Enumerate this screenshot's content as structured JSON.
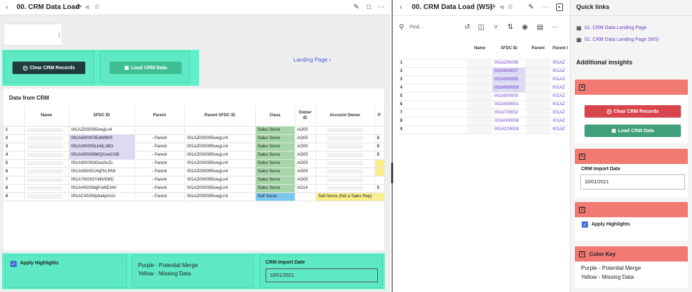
{
  "left": {
    "title": "00. CRM Data Load",
    "clear_btn": "Clear CRM Records",
    "load_btn": "Load CRM Data",
    "landing_link": "Landing Page",
    "grid_title": "Data from CRM",
    "columns": [
      "Name",
      "SFDC ID",
      "Parent",
      "Parent SFDC ID",
      "Class",
      "Owner ID",
      "Account Owner",
      "P"
    ],
    "rows": [
      {
        "n": "1",
        "sfdc": "001AZ000095IvegLn4",
        "sfdc_hl": "",
        "parent": "",
        "psfdc": "",
        "cls": "Sales Serve",
        "cls_hl": "green",
        "owner": "AO05",
        "acct": "",
        "p": "",
        "p_hl": ""
      },
      {
        "n": "2",
        "sfdc": "001A600007lEdWlIKR",
        "sfdc_hl": "purple",
        "parent": "- Parent",
        "psfdc": "001AZ000095IvegLn4",
        "cls": "Sales Serve",
        "cls_hl": "green",
        "owner": "AO05",
        "acct": "",
        "p": "B",
        "p_hl": ""
      },
      {
        "n": "3",
        "sfdc": "001A300005Lb4iL1BO",
        "sfdc_hl": "purple",
        "parent": "- Parent",
        "psfdc": "001AZ000095IvegLn4",
        "cls": "Sales Serve",
        "cls_hl": "green",
        "owner": "AO05",
        "acct": "",
        "p": "B",
        "p_hl": ""
      },
      {
        "n": "4",
        "sfdc": "001AN00008MQXowCGB",
        "sfdc_hl": "purple",
        "parent": "- Parent",
        "psfdc": "001AZ000095IvegLn4",
        "cls": "Sales Serve",
        "cls_hl": "green",
        "owner": "AO05",
        "acct": "",
        "p": "B",
        "p_hl": ""
      },
      {
        "n": "5",
        "sfdc": "001A900000lOoaScZc",
        "sfdc_hl": "",
        "parent": "- Parent",
        "psfdc": "001AZ000095IvegLn4",
        "cls": "Sales Serve",
        "cls_hl": "green",
        "owner": "AO05",
        "acct": "",
        "p": "",
        "p_hl": "yellow"
      },
      {
        "n": "6",
        "sfdc": "001AN00001HqFhLRh9",
        "sfdc_hl": "",
        "parent": "- Parent",
        "psfdc": "001AZ000095IvegLn4",
        "cls": "Sales Serve",
        "cls_hl": "green",
        "owner": "AO05",
        "acct": "",
        "p": "",
        "p_hl": "yellow"
      },
      {
        "n": "7",
        "sfdc": "001A700002Y4llVKMD",
        "sfdc_hl": "",
        "parent": "- Parent",
        "psfdc": "001AZ000095IvegLn4",
        "cls": "Sales Serve",
        "cls_hl": "green",
        "owner": "AO05",
        "acct": "",
        "p": "",
        "p_hl": ""
      },
      {
        "n": "8",
        "sfdc": "001AH00008gFoWE34V",
        "sfdc_hl": "",
        "parent": "- Parent",
        "psfdc": "001AZ000095IvegLn4",
        "cls": "Sales Serve",
        "cls_hl": "green",
        "owner": "AO14",
        "acct": "",
        "p": "B",
        "p_hl": ""
      },
      {
        "n": "9",
        "sfdc": "001AC00009p9a4pmUs",
        "sfdc_hl": "",
        "parent": "- Parent",
        "psfdc": "001AZ000095IvegLn4",
        "cls": "Self Serve",
        "cls_hl": "blue",
        "owner": "",
        "acct": "Self-Serve (Not a Sales Rep)",
        "p": "",
        "p_hl": "yellow"
      }
    ],
    "apply_highlights": "Apply Highlights",
    "legend_purple": "Purple - Potential Merge",
    "legend_yellow": "Yellow - Missing Data",
    "import_label": "CRM Import Date",
    "import_value": "10/01/2021"
  },
  "mid": {
    "title": "00. CRM Data Load (WS)",
    "find_placeholder": "Find...",
    "columns": [
      "Name",
      "SFDC ID",
      "Parent",
      "Parent I"
    ],
    "rows": [
      {
        "n": "1",
        "sfdc": "001AZ00009",
        "hl": false,
        "p": "001AZ"
      },
      {
        "n": "2",
        "sfdc": "001A600007",
        "hl": true,
        "p": "001AZ"
      },
      {
        "n": "3",
        "sfdc": "001A300005",
        "hl": true,
        "p": "001AZ"
      },
      {
        "n": "4",
        "sfdc": "001AN00008",
        "hl": true,
        "p": "001AZ"
      },
      {
        "n": "5",
        "sfdc": "001A900000",
        "hl": false,
        "p": "001AZ"
      },
      {
        "n": "6",
        "sfdc": "001AN00001",
        "hl": false,
        "p": "001AZ"
      },
      {
        "n": "7",
        "sfdc": "001A700002",
        "hl": false,
        "p": "001AZ"
      },
      {
        "n": "8",
        "sfdc": "001AH00008",
        "hl": false,
        "p": "001AZ"
      },
      {
        "n": "9",
        "sfdc": "001AC00009",
        "hl": false,
        "p": "001AZ"
      }
    ]
  },
  "right": {
    "title": "Quick links",
    "link1": "01. CRM Data Landing Page",
    "link2": "01. CRM Data Landing Page (WS)",
    "insights": "Additional insights",
    "clear_btn": "Clear CRM Records",
    "load_btn": "Load CRM Data",
    "import_label": "CRM Import Date",
    "import_value": "10/01/2021",
    "apply_highlights": "Apply Highlights",
    "color_key": "Color Key",
    "legend_purple": "Purple - Potential Merge",
    "legend_yellow": "Yellow - Missing Data"
  },
  "colors": {
    "teal": "#5ff0c9",
    "salmon": "#f27a73",
    "red_btn": "#d8454d",
    "green_btn": "#3fa07a",
    "dark_btn": "#1f3b3c",
    "link": "#6a3dc4"
  }
}
